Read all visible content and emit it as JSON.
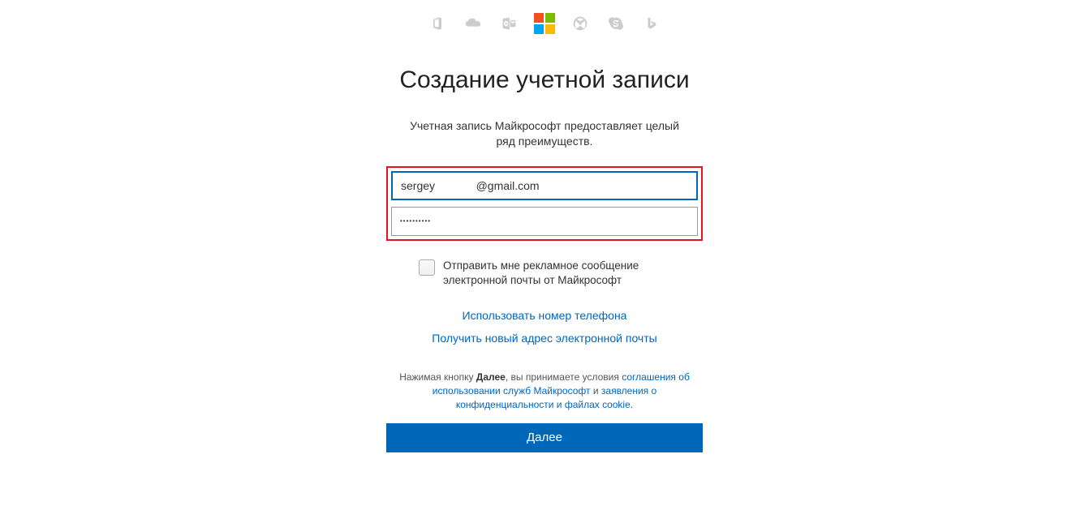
{
  "title": "Создание учетной записи",
  "subtitle": "Учетная запись Майкрософт предоставляет целый ряд преимуществ.",
  "email_value": "sergey             @gmail.com",
  "password_value": "••••••••••",
  "checkbox_label": "Отправить мне рекламное сообщение электронной почты от Майкрософт",
  "link_phone": "Использовать номер телефона",
  "link_new_email": "Получить новый адрес электронной почты",
  "legal_prefix": "Нажимая кнопку ",
  "legal_next": "Далее",
  "legal_mid1": ", вы принимаете условия ",
  "legal_link_terms": "соглашения об использовании служб Майкрософт",
  "legal_mid2": " и ",
  "legal_link_privacy": "заявления о конфиденциальности и файлах cookie",
  "legal_end": ".",
  "next_button": "Далее"
}
